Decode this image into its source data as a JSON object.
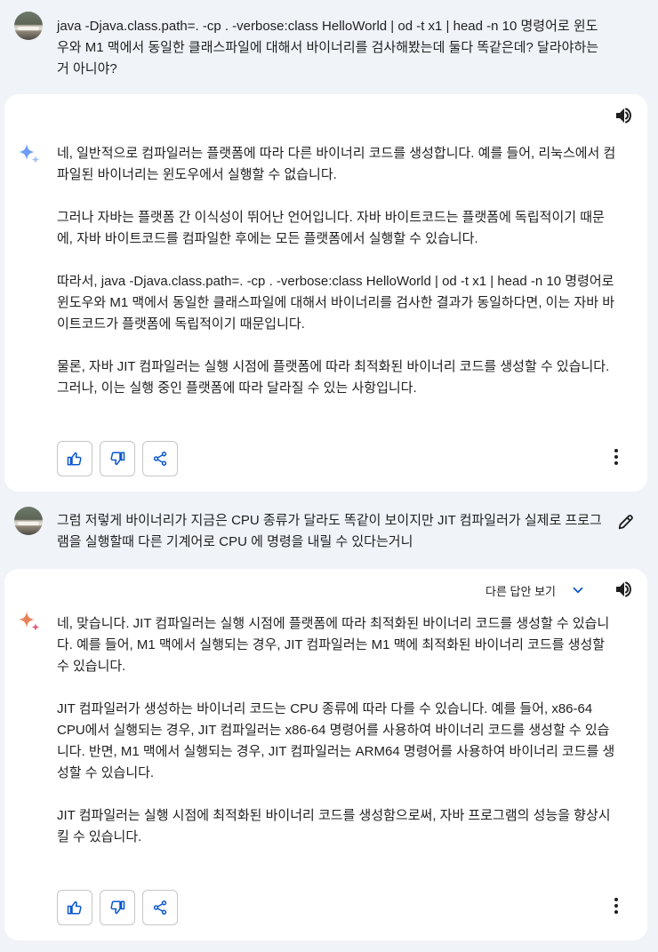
{
  "conversation": [
    {
      "user": {
        "text": "java -Djava.class.path=. -cp . -verbose:class HelloWorld | od -t x1 | head -n 10 명령어로 윈도우와 M1 맥에서 동일한 클래스파일에 대해서 바이너리를 검사해봤는데 둘다 똑같은데? 달라야하는거 아니야?"
      },
      "response": {
        "paragraphs": [
          "네, 일반적으로 컴파일러는 플랫폼에 따라 다른 바이너리 코드를 생성합니다. 예를 들어, 리눅스에서 컴파일된 바이너리는 윈도우에서 실행할 수 없습니다.",
          "그러나 자바는 플랫폼 간 이식성이 뛰어난 언어입니다. 자바 바이트코드는 플랫폼에 독립적이기 때문에, 자바 바이트코드를 컴파일한 후에는 모든 플랫폼에서 실행할 수 있습니다.",
          "따라서, java -Djava.class.path=. -cp . -verbose:class HelloWorld | od -t x1 | head -n 10 명령어로 윈도우와 M1 맥에서 동일한 클래스파일에 대해서 바이너리를 검사한 결과가 동일하다면, 이는 자바 바이트코드가 플랫폼에 독립적이기 때문입니다.",
          "물론, 자바 JIT 컴파일러는 실행 시점에 플랫폼에 따라 최적화된 바이너리 코드를 생성할 수 있습니다. 그러나, 이는 실행 중인 플랫폼에 따라 달라질 수 있는 사항입니다."
        ]
      }
    },
    {
      "user": {
        "text": "그럼 저렇게 바이너리가 지금은 CPU 종류가 달라도 똑같이 보이지만 JIT 컴파일러가 실제로 프로그램을 실행할때 다른 기계어로 CPU 에 명령을 내릴 수 있다는거니"
      },
      "response": {
        "drafts_label": "다른 답안 보기",
        "paragraphs": [
          "네, 맞습니다. JIT 컴파일러는 실행 시점에 플랫폼에 따라 최적화된 바이너리 코드를 생성할 수 있습니다. 예를 들어, M1 맥에서 실행되는 경우, JIT 컴파일러는 M1 맥에 최적화된 바이너리 코드를 생성할 수 있습니다.",
          "JIT 컴파일러가 생성하는 바이너리 코드는 CPU 종류에 따라 다를 수 있습니다. 예를 들어, x86-64 CPU에서 실행되는 경우, JIT 컴파일러는 x86-64 명령어를 사용하여 바이너리 코드를 생성할 수 있습니다. 반면, M1 맥에서 실행되는 경우, JIT 컴파일러는 ARM64 명령어를 사용하여 바이너리 코드를 생성할 수 있습니다.",
          "JIT 컴파일러는 실행 시점에 최적화된 바이너리 코드를 생성함으로써, 자바 프로그램의 성능을 향상시킬 수 있습니다."
        ]
      }
    }
  ],
  "icons": {
    "speaker": "volume-icon",
    "like": "thumb-up-icon",
    "dislike": "thumb-down-icon",
    "share": "share-icon",
    "more": "more-vert-icon",
    "edit": "edit-pencil-icon",
    "spark": "gemini-spark-icon",
    "chevron": "chevron-down-icon"
  },
  "colors": {
    "background": "#f0f4f9",
    "card": "#ffffff",
    "spark_blue": "#4b8ef5",
    "spark_orange": "#e8825a",
    "accent": "#0b57d0"
  }
}
